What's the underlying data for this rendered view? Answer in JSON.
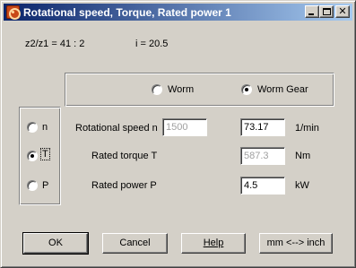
{
  "window": {
    "title": "Rotational speed, Torque, Rated power  1",
    "controls": {
      "minimize": "minimize",
      "maximize": "maximize",
      "close": "✕"
    }
  },
  "ratio": {
    "z_ratio": "z2/z1 = 41 : 2",
    "i_ratio": "i = 20.5"
  },
  "gear_type": {
    "options": [
      {
        "label": "Worm",
        "checked": false
      },
      {
        "label": "Worm Gear",
        "checked": true
      }
    ]
  },
  "mode": {
    "options": [
      {
        "label": "n",
        "checked": false
      },
      {
        "label": "T",
        "checked": true
      },
      {
        "label": "P",
        "checked": false
      }
    ]
  },
  "rows": [
    {
      "label": "Rotational speed n",
      "input_value": "1500",
      "result_value": "73.17",
      "unit": "1/min"
    },
    {
      "label": "Rated torque T",
      "result_value": "587.3",
      "unit": "Nm"
    },
    {
      "label": "Rated power P",
      "result_value": "4.5",
      "unit": "kW"
    }
  ],
  "buttons": {
    "ok": "OK",
    "cancel": "Cancel",
    "help": "Help",
    "units": "mm <--> inch"
  }
}
